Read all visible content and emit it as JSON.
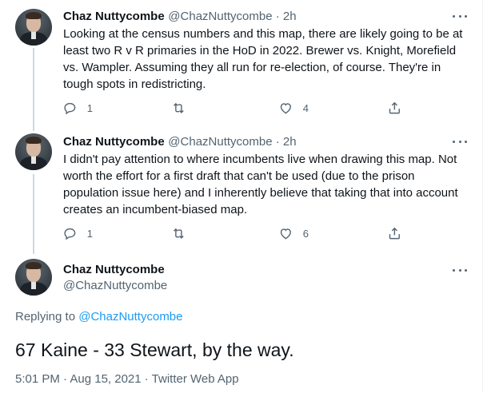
{
  "tweets": [
    {
      "name": "Chaz Nuttycombe",
      "handle": "@ChazNuttycombe",
      "time": "2h",
      "text": "Looking at the census numbers and this map, there are likely going to be at least two R v R primaries in the HoD in 2022. Brewer vs. Knight, Morefield vs. Wampler. Assuming they all run for re-election, of course. They're in tough spots in redistricting.",
      "replies": "1",
      "retweets": "",
      "likes": "4"
    },
    {
      "name": "Chaz Nuttycombe",
      "handle": "@ChazNuttycombe",
      "time": "2h",
      "text": "I didn't pay attention to where incumbents live when drawing this map. Not worth the effort for a first draft that can't be used (due to the prison population issue here) and I inherently believe that taking that into account creates an incumbent-biased map.",
      "replies": "1",
      "retweets": "",
      "likes": "6"
    }
  ],
  "focus": {
    "name": "Chaz Nuttycombe",
    "handle": "@ChazNuttycombe",
    "replying_prefix": "Replying to",
    "replying_to": "@ChazNuttycombe",
    "text": "67 Kaine - 33 Stewart, by the way.",
    "timestamp": "5:01 PM · Aug 15, 2021 · Twitter Web App"
  },
  "separator": " · ",
  "icons": {
    "reply": "reply-icon",
    "retweet": "retweet-icon",
    "like": "heart-icon",
    "share": "share-icon",
    "more": "more-icon"
  },
  "colors": {
    "link": "#1d9bf0",
    "secondary_text": "#536471",
    "thread_line": "#cfd9de"
  }
}
